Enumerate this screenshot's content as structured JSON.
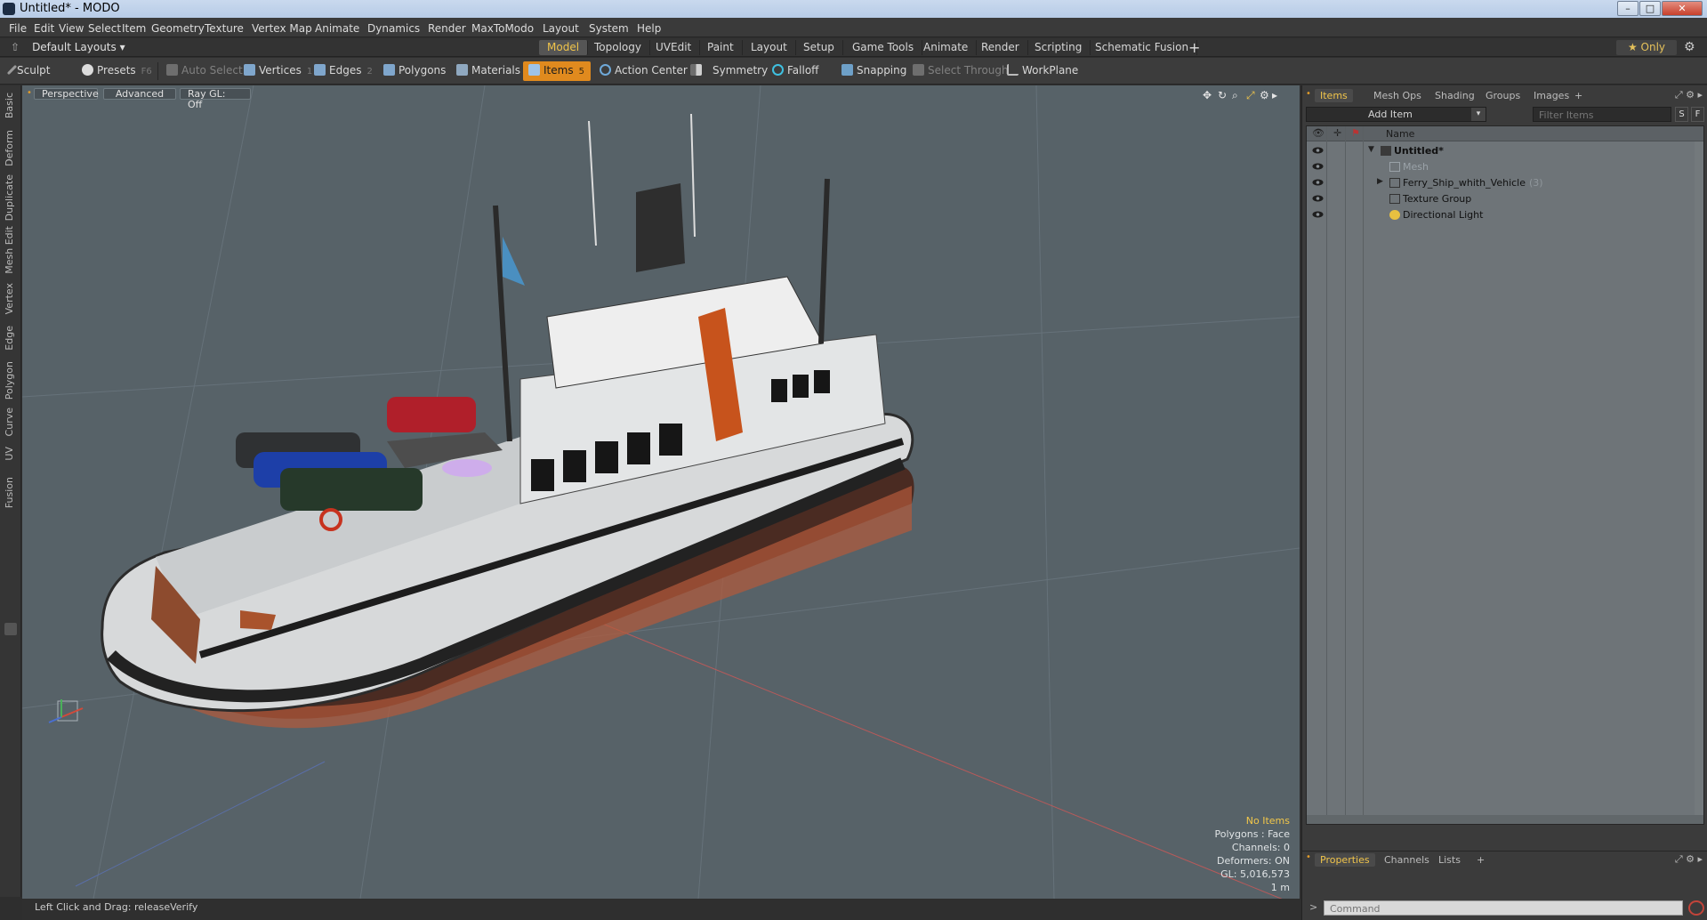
{
  "window": {
    "title": "Untitled* - MODO",
    "min": "–",
    "max": "□",
    "close": "✕"
  },
  "menu": [
    "File",
    "Edit",
    "View",
    "Select",
    "Item",
    "Geometry",
    "Texture",
    "Vertex Map",
    "Animate",
    "Dynamics",
    "Render",
    "MaxToModo",
    "Layout",
    "System",
    "Help"
  ],
  "layouts": {
    "label": "Default Layouts ▾",
    "up_icon": "⇧"
  },
  "tabs": [
    "Model",
    "Topology",
    "UVEdit",
    "Paint",
    "Layout",
    "Setup",
    "Game Tools",
    "Animate",
    "Render",
    "Scripting",
    "Schematic Fusion"
  ],
  "tabs_active": "Model",
  "tabs_plus": "+",
  "only_button": "★  Only",
  "gear_glyph": "⚙",
  "toolbar": {
    "sculpt": "Sculpt",
    "presets": "Presets",
    "presets_key": "F6",
    "auto_select": "Auto Select",
    "vertices": "Vertices",
    "vertices_key": "1",
    "edges": "Edges",
    "edges_key": "2",
    "polygons": "Polygons",
    "materials": "Materials",
    "items": "Items",
    "items_key": "5",
    "action_center": "Action Center",
    "symmetry": "Symmetry",
    "falloff": "Falloff",
    "snapping": "Snapping",
    "select_through": "Select Through",
    "workplane": "WorkPlane"
  },
  "left_rail": [
    "Basic",
    "Deform",
    "Duplicate",
    "Mesh Edit",
    "Vertex",
    "Edge",
    "Polygon",
    "Curve",
    "UV",
    "Fusion"
  ],
  "viewport": {
    "mode": "Perspective",
    "shading": "Advanced",
    "raygl": "Ray GL: Off",
    "icons": [
      "move-view-icon",
      "rotate-view-icon",
      "zoom-view-icon",
      "maximize-view-icon",
      "viewport-settings-icon",
      "viewport-menu-icon"
    ],
    "icon_glyphs": [
      "✥",
      "↻",
      "⌕",
      "⤢",
      "⚙",
      "▸"
    ],
    "info": {
      "no_items": "No Items",
      "polygons": "Polygons : Face",
      "channels": "Channels: 0",
      "deformers": "Deformers: ON",
      "gl": "GL: 5,016,573",
      "scale": "1 m"
    }
  },
  "status": {
    "hint": "Left Click and Drag:  releaseVerify"
  },
  "right_panel": {
    "tabs": [
      "Items",
      "Mesh Ops",
      "Shading",
      "Groups",
      "Images",
      "+"
    ],
    "active": "Items",
    "tools": "⤢ ⚙ ▸",
    "add_item": "Add Item",
    "add_item_dd": "▾",
    "filter_placeholder": "Filter Items",
    "s_btn": "S",
    "f_btn": "F",
    "columns": {
      "name": "Name",
      "eye": "👁",
      "lock": "✛",
      "pin": "⚑"
    },
    "items": [
      {
        "label": "Untitled*",
        "exp": "▼",
        "count": ""
      },
      {
        "label": "Mesh",
        "exp": "",
        "count": ""
      },
      {
        "label": "Ferry_Ship_whith_Vehicle",
        "exp": "▶",
        "count": "(3)"
      },
      {
        "label": "Texture Group",
        "exp": "",
        "count": ""
      },
      {
        "label": "Directional Light",
        "exp": "",
        "count": ""
      }
    ]
  },
  "props": {
    "tabs": [
      "Properties",
      "Channels",
      "Lists",
      "+"
    ],
    "active": "Properties",
    "tools": "⤢ ⚙ ▸",
    "command_placeholder": "Command",
    "cmd_arrow": ">"
  },
  "colors": {
    "accent": "#e08a1e",
    "active_tab": "#f0c44a",
    "viewport_bg": "#576268",
    "hull_white": "#d7d9da",
    "stripe": "#c7531c"
  }
}
